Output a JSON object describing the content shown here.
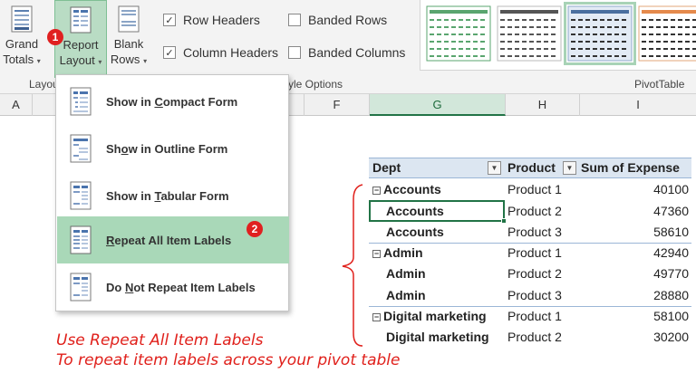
{
  "ribbon": {
    "grand_totals": {
      "line1": "Grand",
      "line2": "Totals"
    },
    "report_layout": {
      "line1": "Report",
      "line2": "Layout"
    },
    "blank_rows": {
      "line1": "Blank",
      "line2": "Rows"
    },
    "layout_group_label": "Layou",
    "style_options_label": "yle Options",
    "pivottable_styles_label": "PivotTable",
    "row_headers": {
      "label": "Row Headers",
      "checked": true
    },
    "column_headers": {
      "label": "Column Headers",
      "checked": true
    },
    "banded_rows": {
      "label": "Banded Rows",
      "checked": false
    },
    "banded_columns": {
      "label": "Banded Columns",
      "checked": false
    },
    "caret_glyph": "▾",
    "check_glyph": "✓"
  },
  "badges": {
    "one": "1",
    "two": "2"
  },
  "column_headers": {
    "a": "A",
    "f": "F",
    "g": "G",
    "h": "H",
    "i": "I"
  },
  "menu": {
    "items": [
      {
        "pre": "Show in ",
        "ul": "C",
        "post": "ompact Form"
      },
      {
        "pre": "Sh",
        "ul": "o",
        "post": "w in Outline Form"
      },
      {
        "pre": "Show in ",
        "ul": "T",
        "post": "abular Form"
      },
      {
        "pre": "",
        "ul": "R",
        "post": "epeat All Item Labels"
      },
      {
        "pre": "Do ",
        "ul": "N",
        "post": "ot Repeat Item Labels"
      }
    ]
  },
  "pivot": {
    "headers": {
      "dept": "Dept",
      "product": "Product",
      "sum": "Sum of Expense"
    },
    "filter_glyph": "▼",
    "collapse_glyph": "−",
    "rows": [
      {
        "dept": "Accounts",
        "product": "Product 1",
        "value": "40100"
      },
      {
        "dept": "Accounts",
        "product": "Product 2",
        "value": "47360"
      },
      {
        "dept": "Accounts",
        "product": "Product 3",
        "value": "58610"
      },
      {
        "dept": "Admin",
        "product": "Product 1",
        "value": "42940"
      },
      {
        "dept": "Admin",
        "product": "Product 2",
        "value": "49770"
      },
      {
        "dept": "Admin",
        "product": "Product 3",
        "value": "28880"
      },
      {
        "dept": "Digital marketing",
        "product": "Product 1",
        "value": "58100"
      },
      {
        "dept": "Digital marketing",
        "product": "Product 2",
        "value": "30200"
      }
    ]
  },
  "annotation": {
    "line1": "Use Repeat All Item Labels",
    "line2": "To repeat item labels across your pivot table"
  },
  "colors": {
    "accent_green": "#217346",
    "highlight": "#a9d8b8",
    "annotation_red": "#e0201b",
    "pivot_header": "#dce6f1"
  }
}
